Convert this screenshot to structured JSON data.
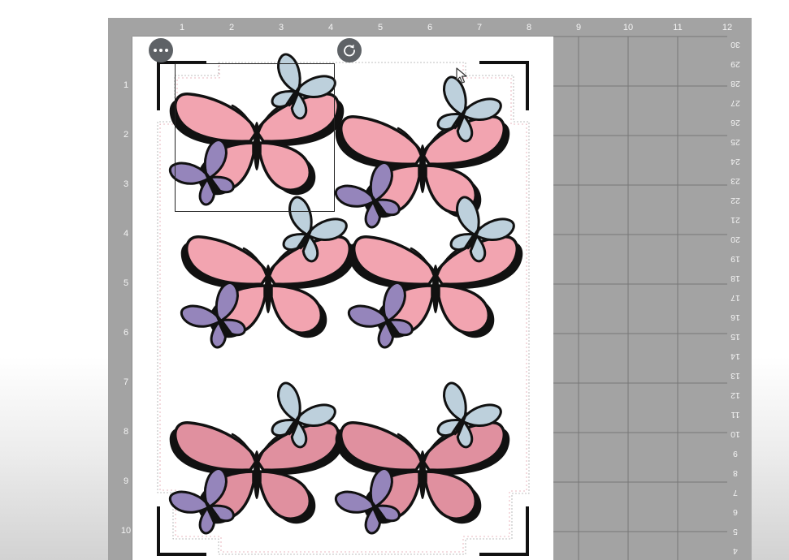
{
  "colors": {
    "mat": "#a3a3a3",
    "grid_line": "#777777",
    "sheet": "#ffffff",
    "wing_pink": "#f2a4b0",
    "wing_pink_dark": "#e0909f",
    "butterfly_blue": "#bdd0dc",
    "butterfly_purple": "#9585bb",
    "outline": "#111111",
    "button_bg": "#5e6266"
  },
  "ruler": {
    "top": [
      "1",
      "2",
      "3",
      "4",
      "5",
      "6",
      "7",
      "8",
      "9",
      "10",
      "11",
      "12"
    ],
    "left": [
      "1",
      "2",
      "3",
      "4",
      "5",
      "6",
      "7",
      "8",
      "9",
      "10"
    ],
    "right": [
      "30",
      "29",
      "28",
      "27",
      "26",
      "25",
      "24",
      "23",
      "22",
      "21",
      "20",
      "19",
      "18",
      "17",
      "16",
      "15",
      "14",
      "13",
      "12",
      "11",
      "10",
      "9",
      "8",
      "7",
      "6",
      "5",
      "4"
    ]
  },
  "canvas": {
    "more_button_icon": "more-horizontal-icon",
    "rotate_button_icon": "rotate-icon",
    "design_icon": "butterfly-cluster",
    "cursor_icon": "arrow-cursor-icon"
  }
}
